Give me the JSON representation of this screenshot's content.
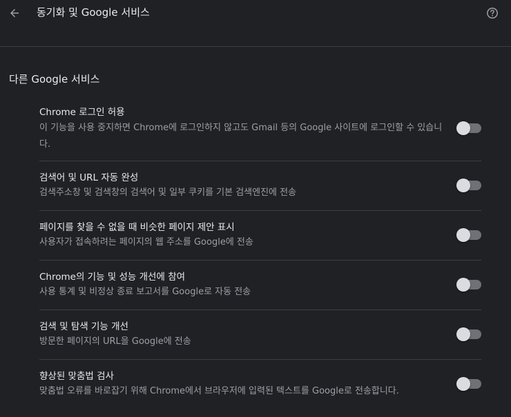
{
  "header": {
    "title": "동기화 및 Google 서비스",
    "back_icon": "arrow-back-icon",
    "help_icon": "help-circle-icon"
  },
  "section": {
    "title": "다른 Google 서비스"
  },
  "settings": [
    {
      "label": "Chrome 로그인 허용",
      "description": "이 기능을 사용 중지하면 Chrome에 로그인하지 않고도 Gmail 등의 Google 사이트에 로그인할 수 있습니다.",
      "enabled": false
    },
    {
      "label": "검색어 및 URL 자동 완성",
      "description": "검색주소창 및 검색창의 검색어 및 일부 쿠키를 기본 검색엔진에 전송",
      "enabled": false
    },
    {
      "label": "페이지를 찾을 수 없을 때 비슷한 페이지 제안 표시",
      "description": "사용자가 접속하려는 페이지의 웹 주소를 Google에 전송",
      "enabled": false
    },
    {
      "label": "Chrome의 기능 및 성능 개선에 참여",
      "description": "사용 통계 및 비정상 종료 보고서를 Google로 자동 전송",
      "enabled": false
    },
    {
      "label": "검색 및 탐색 기능 개선",
      "description": "방문한 페이지의 URL을 Google에 전송",
      "enabled": false
    },
    {
      "label": "향상된 맞춤법 검사",
      "description": "맞춤법 오류를 바로잡기 위해 Chrome에서 브라우저에 입력된 텍스트를 Google로 전송합니다.",
      "enabled": false
    }
  ],
  "colors": {
    "background": "#202124",
    "text_primary": "#e8eaed",
    "text_secondary": "#9aa0a6",
    "divider": "#3c4043",
    "toggle_track_off": "#6e7175",
    "toggle_knob_off": "#dadce0"
  }
}
